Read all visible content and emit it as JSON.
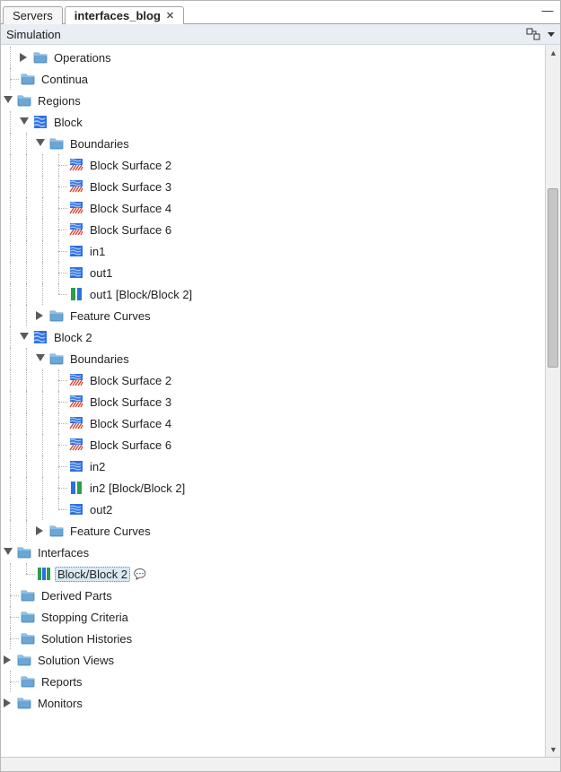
{
  "tabs": {
    "servers": "Servers",
    "active": "interfaces_blog"
  },
  "section_title": "Simulation",
  "tree": {
    "operations": "Operations",
    "continua": "Continua",
    "regions": "Regions",
    "block1": {
      "name": "Block",
      "boundaries": "Boundaries",
      "surf2": "Block Surface 2",
      "surf3": "Block Surface 3",
      "surf4": "Block Surface 4",
      "surf6": "Block Surface 6",
      "in1": "in1",
      "out1": "out1",
      "out1_if": "out1 [Block/Block 2]",
      "feature_curves": "Feature Curves"
    },
    "block2": {
      "name": "Block 2",
      "boundaries": "Boundaries",
      "surf2": "Block Surface 2",
      "surf3": "Block Surface 3",
      "surf4": "Block Surface 4",
      "surf6": "Block Surface 6",
      "in2": "in2",
      "in2_if": "in2 [Block/Block 2]",
      "out2": "out2",
      "feature_curves": "Feature Curves"
    },
    "interfaces": "Interfaces",
    "interfaces_item": "Block/Block 2",
    "derived_parts": "Derived Parts",
    "stopping_criteria": "Stopping Criteria",
    "solution_histories": "Solution Histories",
    "solution_views": "Solution Views",
    "reports": "Reports",
    "monitors": "Monitors"
  }
}
